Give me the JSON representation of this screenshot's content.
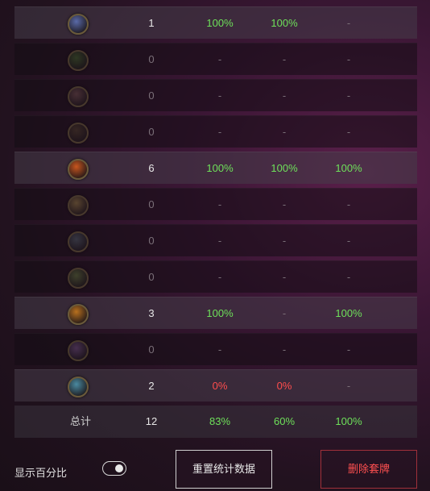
{
  "rows": [
    {
      "count": "1",
      "p1": "100%",
      "p2": "100%",
      "p3": "-",
      "c1": "green",
      "c2": "green",
      "c3": "gray",
      "icon": "compass-icon",
      "iconColor": "#5a6aa8",
      "lit": true
    },
    {
      "count": "0",
      "p1": "-",
      "p2": "-",
      "p3": "-",
      "c1": "gray",
      "c2": "gray",
      "c3": "gray",
      "icon": "hunter-icon",
      "iconColor": "#3d5a2a",
      "lit": false
    },
    {
      "count": "0",
      "p1": "-",
      "p2": "-",
      "p3": "-",
      "c1": "gray",
      "c2": "gray",
      "c3": "gray",
      "icon": "beast-icon",
      "iconColor": "#6a4a4a",
      "lit": false
    },
    {
      "count": "0",
      "p1": "-",
      "p2": "-",
      "p3": "-",
      "c1": "gray",
      "c2": "gray",
      "c3": "gray",
      "icon": "rogue-icon",
      "iconColor": "#4a3a2a",
      "lit": false
    },
    {
      "count": "6",
      "p1": "100%",
      "p2": "100%",
      "p3": "100%",
      "c1": "green",
      "c2": "green",
      "c3": "green",
      "icon": "fire-icon",
      "iconColor": "#c8561e",
      "lit": true
    },
    {
      "count": "0",
      "p1": "-",
      "p2": "-",
      "p3": "-",
      "c1": "gray",
      "c2": "gray",
      "c3": "gray",
      "icon": "holy-icon",
      "iconColor": "#8a7040",
      "lit": false
    },
    {
      "count": "0",
      "p1": "-",
      "p2": "-",
      "p3": "-",
      "c1": "gray",
      "c2": "gray",
      "c3": "gray",
      "icon": "sword-icon",
      "iconColor": "#4a5560",
      "lit": false
    },
    {
      "count": "0",
      "p1": "-",
      "p2": "-",
      "p3": "-",
      "c1": "gray",
      "c2": "gray",
      "c3": "gray",
      "icon": "nature-icon",
      "iconColor": "#5a6a3a",
      "lit": false
    },
    {
      "count": "3",
      "p1": "100%",
      "p2": "-",
      "p3": "100%",
      "c1": "green",
      "c2": "gray",
      "c3": "green",
      "icon": "warrior-icon",
      "iconColor": "#b8701e",
      "lit": true
    },
    {
      "count": "0",
      "p1": "-",
      "p2": "-",
      "p3": "-",
      "c1": "gray",
      "c2": "gray",
      "c3": "gray",
      "icon": "shadow-icon",
      "iconColor": "#6a4a7a",
      "lit": false
    },
    {
      "count": "2",
      "p1": "0%",
      "p2": "0%",
      "p3": "-",
      "c1": "red",
      "c2": "red",
      "c3": "gray",
      "icon": "blade-icon",
      "iconColor": "#4a8aa0",
      "lit": true
    }
  ],
  "total": {
    "label": "总计",
    "count": "12",
    "p1": "83%",
    "p2": "60%",
    "p3": "100%"
  },
  "footer": {
    "show_percent_label": "显示百分比",
    "reset_button": "重置统计数据",
    "delete_button": "删除套牌"
  }
}
